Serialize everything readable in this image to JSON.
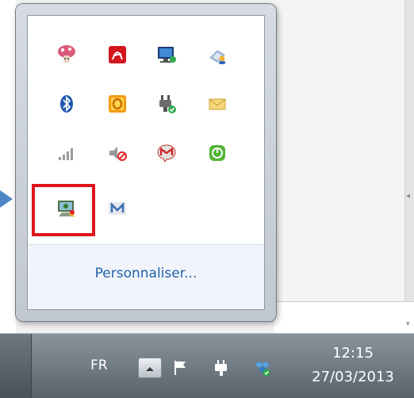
{
  "popup": {
    "customize_label": "Personnaliser..."
  },
  "tray_icons": [
    {
      "name": "mushroom-app-icon"
    },
    {
      "name": "acrobat-icon"
    },
    {
      "name": "monitor-network-icon"
    },
    {
      "name": "keyboard-user-icon"
    },
    {
      "name": "bluetooth-icon"
    },
    {
      "name": "orange-o-icon"
    },
    {
      "name": "power-plug-icon"
    },
    {
      "name": "mail-envelope-icon"
    },
    {
      "name": "signal-bars-icon"
    },
    {
      "name": "volume-muted-icon"
    },
    {
      "name": "gmail-notifier-icon"
    },
    {
      "name": "green-chat-icon"
    },
    {
      "name": "vm-manager-icon"
    },
    {
      "name": "m-app-icon"
    }
  ],
  "taskbar": {
    "language": "FR",
    "time": "12:15",
    "date": "27/03/2013"
  },
  "colors": {
    "highlight_border": "#e0141b",
    "link": "#2260a8",
    "pointer": "#4f86c6"
  }
}
